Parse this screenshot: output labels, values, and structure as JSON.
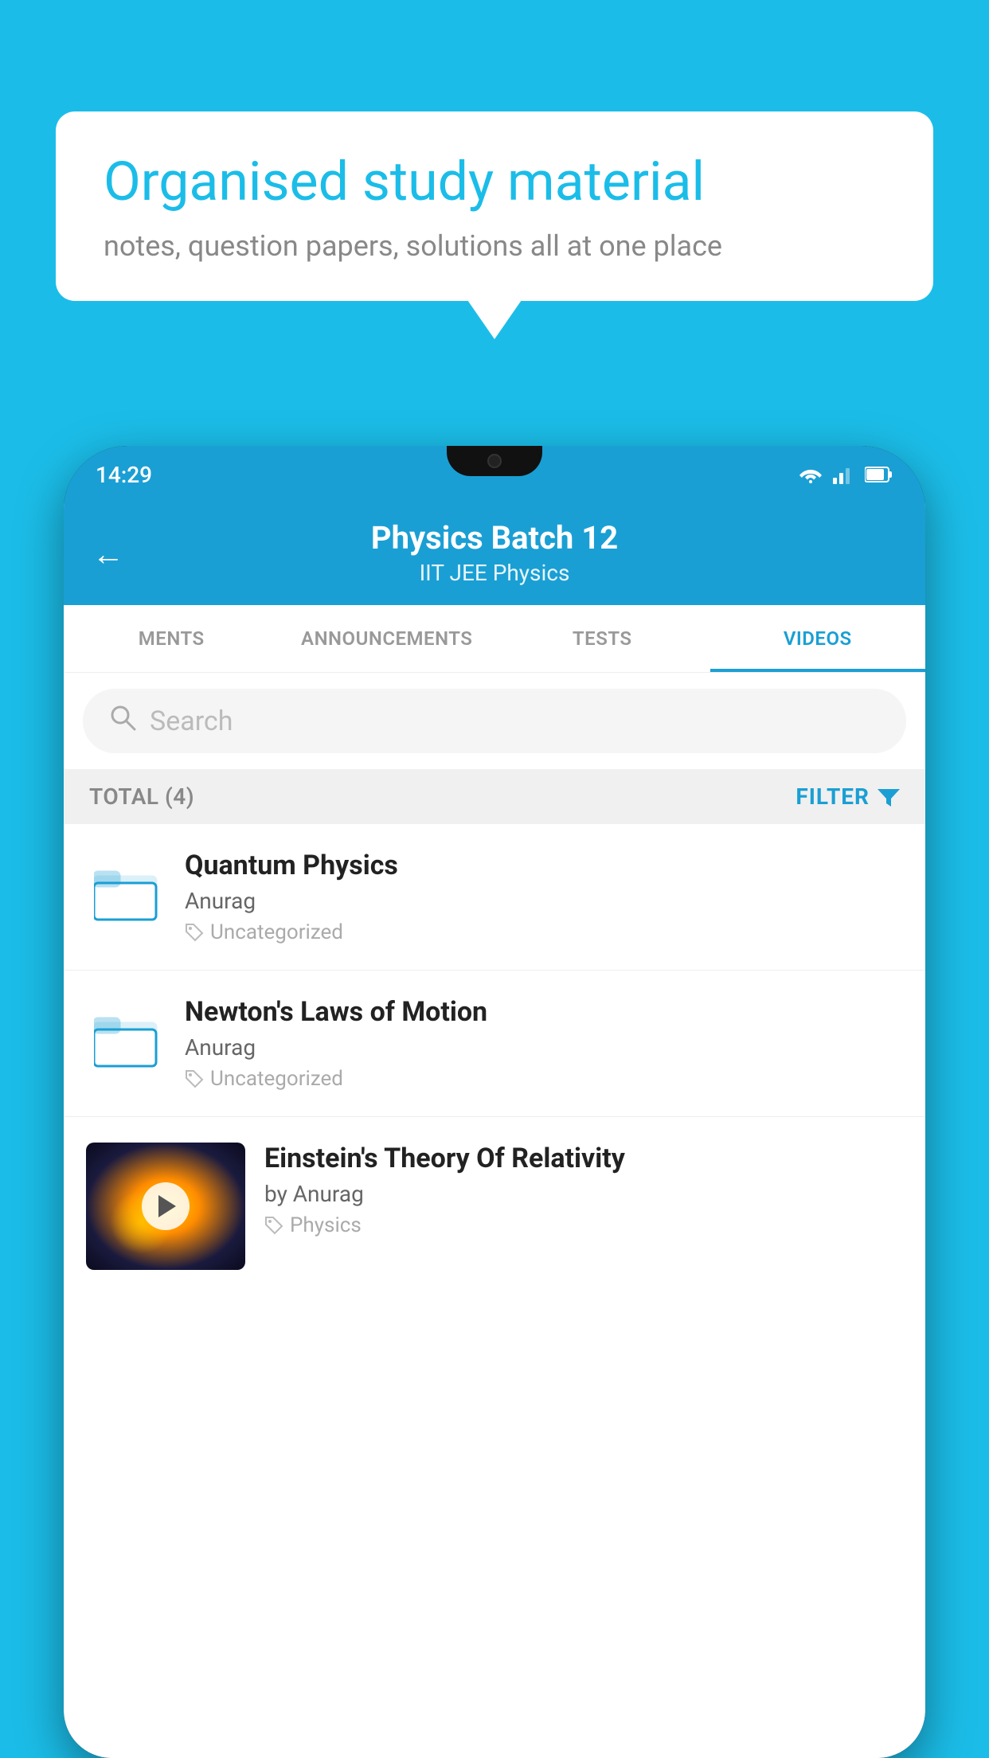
{
  "background_color": "#1BBDE8",
  "speech_bubble": {
    "title": "Organised study material",
    "subtitle": "notes, question papers, solutions all at one place"
  },
  "status_bar": {
    "time": "14:29"
  },
  "app_header": {
    "title": "Physics Batch 12",
    "subtitle": "IIT JEE   Physics",
    "back_label": "←"
  },
  "tabs": [
    {
      "label": "MENTS",
      "active": false
    },
    {
      "label": "ANNOUNCEMENTS",
      "active": false
    },
    {
      "label": "TESTS",
      "active": false
    },
    {
      "label": "VIDEOS",
      "active": true
    }
  ],
  "search": {
    "placeholder": "Search"
  },
  "filter_bar": {
    "total_label": "TOTAL (4)",
    "filter_label": "FILTER"
  },
  "videos": [
    {
      "title": "Quantum Physics",
      "author": "Anurag",
      "tag": "Uncategorized",
      "type": "folder"
    },
    {
      "title": "Newton's Laws of Motion",
      "author": "Anurag",
      "tag": "Uncategorized",
      "type": "folder"
    },
    {
      "title": "Einstein's Theory Of Relativity",
      "author": "by Anurag",
      "tag": "Physics",
      "type": "video"
    }
  ]
}
